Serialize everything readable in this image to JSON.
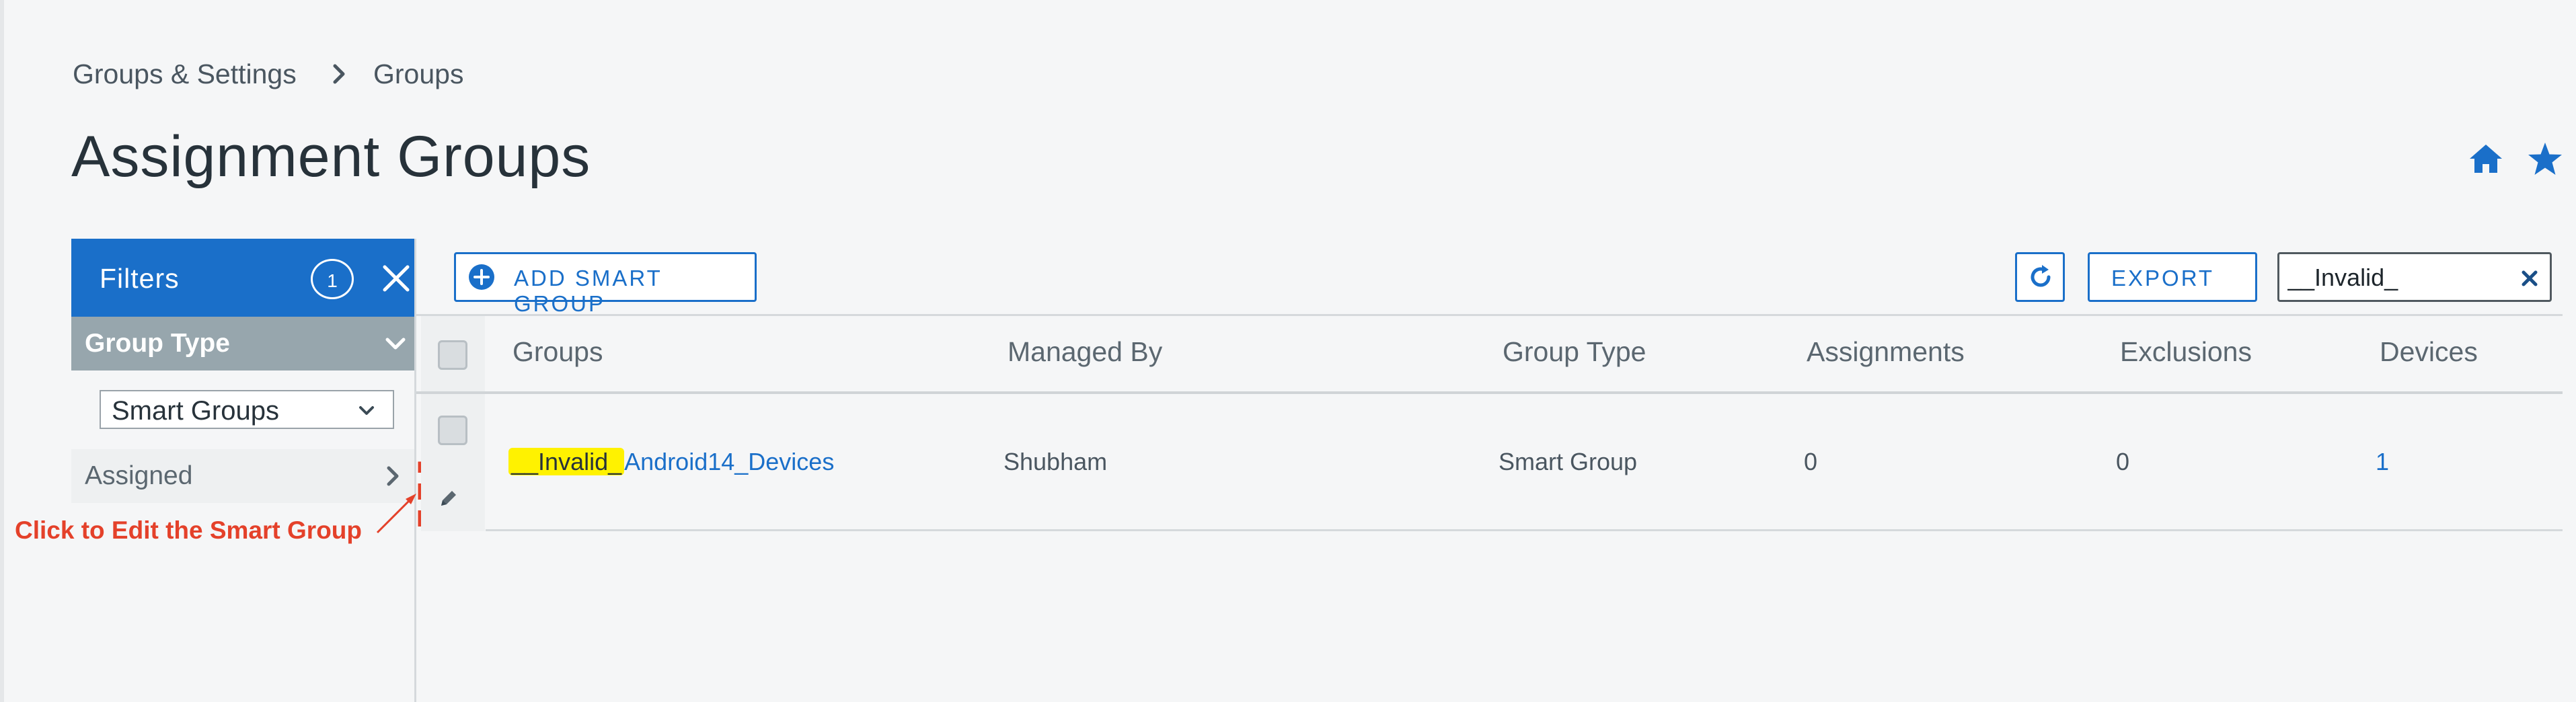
{
  "breadcrumb": {
    "parent": "Groups & Settings",
    "current": "Groups"
  },
  "page": {
    "title": "Assignment Groups"
  },
  "filters": {
    "title": "Filters",
    "count": "1",
    "group_type_label": "Group Type",
    "group_type_selected": "Smart Groups",
    "assigned_label": "Assigned"
  },
  "annotation": {
    "text": "Click to Edit the Smart Group",
    "color": "#e4412a"
  },
  "toolbar": {
    "add_label": "ADD SMART GROUP",
    "export_label": "EXPORT",
    "search_value": "__Invalid_"
  },
  "table": {
    "columns": [
      "Groups",
      "Managed By",
      "Group Type",
      "Assignments",
      "Exclusions",
      "Devices"
    ],
    "rows": [
      {
        "name_highlight": "__Invalid_",
        "name_rest": "Android14_Devices",
        "managed_by": "Shubham",
        "group_type": "Smart Group",
        "assignments": "0",
        "exclusions": "0",
        "devices": "1"
      }
    ]
  },
  "icons": {
    "home": "home-icon",
    "favorite": "star-icon",
    "add": "plus-circle-icon",
    "refresh": "refresh-icon",
    "clear": "close-icon",
    "edit": "pencil-icon"
  },
  "colors": {
    "accent": "#1a6fc9",
    "panel_header": "#1a6fc9",
    "group_type_header": "#97a6ad",
    "highlight": "#fff200"
  }
}
